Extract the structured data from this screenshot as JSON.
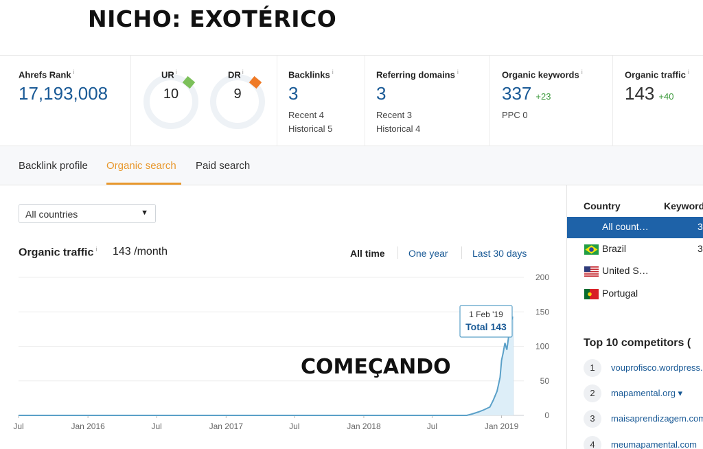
{
  "headline": "NICHO: EXOTÉRICO",
  "annotation": "COMEÇANDO",
  "metrics": {
    "ahrefs_rank": {
      "label": "Ahrefs Rank",
      "info": "i",
      "value": "17,193,008"
    },
    "ur": {
      "label": "UR",
      "info": "i",
      "value": "10",
      "accent": "#7cc05a"
    },
    "dr": {
      "label": "DR",
      "info": "i",
      "value": "9",
      "accent": "#ef7a26"
    },
    "backlinks": {
      "label": "Backlinks",
      "info": "i",
      "value": "3",
      "recent": "Recent 4",
      "historical": "Historical 5"
    },
    "referring_domains": {
      "label": "Referring domains",
      "info": "i",
      "value": "3",
      "recent": "Recent 3",
      "historical": "Historical 4"
    },
    "organic_keywords": {
      "label": "Organic keywords",
      "info": "i",
      "value": "337",
      "delta": "+23",
      "ppc": "PPC 0"
    },
    "organic_traffic": {
      "label": "Organic traffic",
      "info": "i",
      "value": "143",
      "delta": "+40"
    }
  },
  "tabs": [
    "Backlink profile",
    "Organic search",
    "Paid search"
  ],
  "active_tab": "Organic search",
  "countries_select": {
    "value": "All countries",
    "caret": "▼"
  },
  "organic_traffic_panel": {
    "title": "Organic traffic",
    "info": "i",
    "value": "143 /month",
    "ranges": [
      "All time",
      "One year",
      "Last 30 days"
    ],
    "active_range": "All time"
  },
  "tooltip": {
    "date": "1 Feb '19",
    "total": "Total 143"
  },
  "colors": {
    "accent_orange": "#e8982d",
    "link_blue": "#1a5a96",
    "selected_row": "#1e62a8",
    "line": "#5aa0c8",
    "delta_green": "#3c9a3c"
  },
  "chart_data": {
    "type": "area",
    "x_tick_labels": [
      "Jul",
      "Jan 2016",
      "Jul",
      "Jan 2017",
      "Jul",
      "Jan 2018",
      "Jul",
      "Jan 2019"
    ],
    "y_tick_labels": [
      "200",
      "150",
      "100",
      "50",
      "0"
    ],
    "ylim": [
      0,
      200
    ],
    "xlim": [
      "2015-07",
      "2019-03"
    ],
    "x": [
      "2015-07-01",
      "2018-10-01",
      "2018-10-15",
      "2018-11-01",
      "2018-11-15",
      "2018-12-01",
      "2018-12-10",
      "2018-12-20",
      "2018-12-28",
      "2019-01-01",
      "2019-01-05",
      "2019-01-10",
      "2019-01-15",
      "2019-01-20",
      "2019-01-25",
      "2019-02-01"
    ],
    "y": [
      0,
      0,
      2,
      5,
      8,
      12,
      22,
      35,
      55,
      80,
      90,
      105,
      95,
      115,
      135,
      143
    ],
    "tooltip_point": {
      "x": "2019-02-01",
      "y": 143
    }
  },
  "right_panel": {
    "headers": {
      "country": "Country",
      "keywords": "Keywords"
    },
    "countries": [
      {
        "name": "All count…",
        "keywords": "3",
        "selected": true,
        "flag": ""
      },
      {
        "name": "Brazil",
        "keywords": "3",
        "selected": false,
        "flag": "brazil-flag-icon"
      },
      {
        "name": "United S…",
        "keywords": "",
        "selected": false,
        "flag": "us-flag-icon"
      },
      {
        "name": "Portugal",
        "keywords": "",
        "selected": false,
        "flag": "portugal-flag-icon"
      }
    ],
    "competitors_title": "Top 10 competitors (",
    "competitors": [
      {
        "rank": "1",
        "domain": "vouprofisco.wordpress.com"
      },
      {
        "rank": "2",
        "domain": "mapamental.org ▾"
      },
      {
        "rank": "3",
        "domain": "maisaprendizagem.com"
      },
      {
        "rank": "4",
        "domain": "meumapamental.com"
      }
    ]
  }
}
